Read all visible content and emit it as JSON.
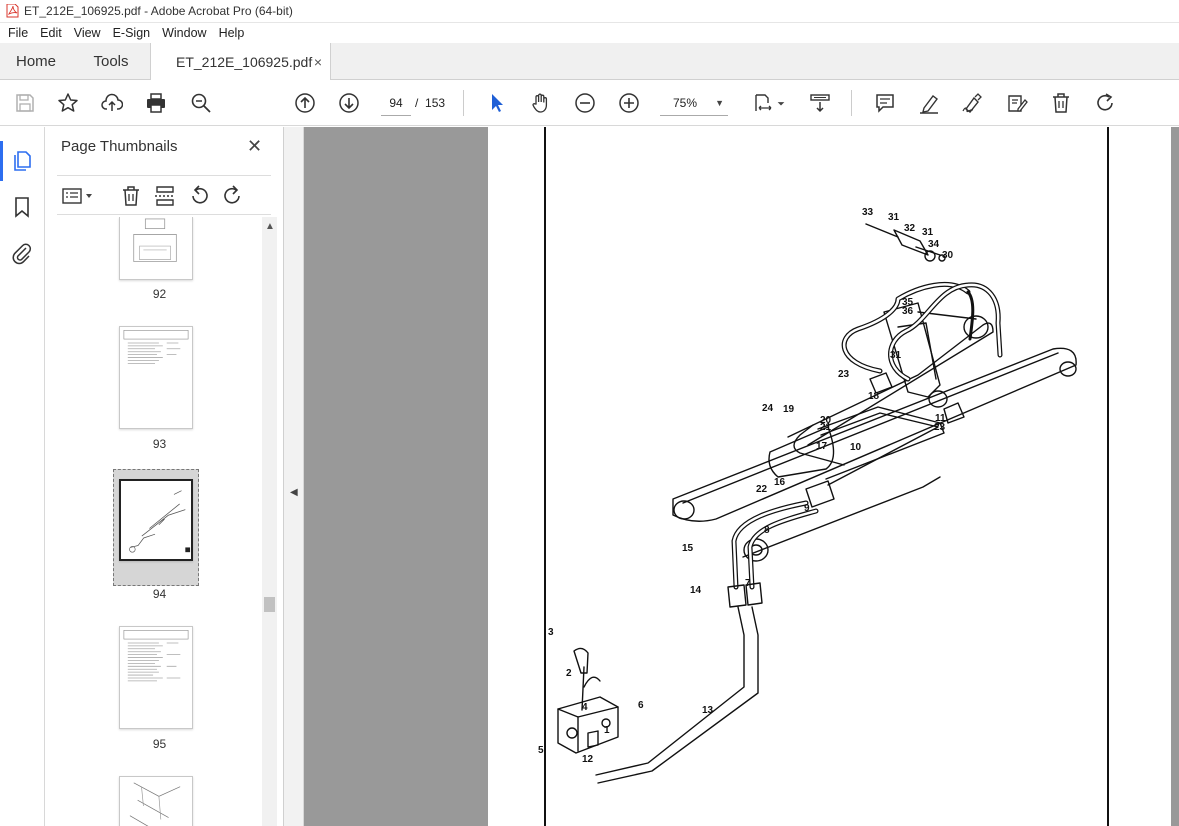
{
  "window": {
    "title": "ET_212E_106925.pdf - Adobe Acrobat Pro (64-bit)"
  },
  "menu": [
    "File",
    "Edit",
    "View",
    "E-Sign",
    "Window",
    "Help"
  ],
  "tabs": {
    "home": "Home",
    "tools": "Tools",
    "document": "ET_212E_106925.pdf",
    "close": "×"
  },
  "toolbar": {
    "current_page": "94",
    "page_separator": "/",
    "total_pages": "153",
    "zoom": "75%"
  },
  "thumbnails_panel": {
    "title": "Page Thumbnails",
    "close": "✕",
    "pages": [
      {
        "label": "92"
      },
      {
        "label": "93"
      },
      {
        "label": "94",
        "selected": true
      },
      {
        "label": "95"
      }
    ]
  },
  "diagram": {
    "callouts": [
      "33",
      "31",
      "32",
      "31",
      "34",
      "30",
      "35",
      "36",
      "31",
      "23",
      "18",
      "19",
      "24",
      "20",
      "21",
      "11",
      "23",
      "17",
      "10",
      "16",
      "22",
      "9",
      "8",
      "15",
      "14",
      "7",
      "3",
      "2",
      "4",
      "1",
      "6",
      "13",
      "5",
      "12"
    ]
  },
  "colors": {
    "accent": "#2d6ef0",
    "pdf_red": "#d9342b",
    "viewer_bg": "#999999"
  }
}
